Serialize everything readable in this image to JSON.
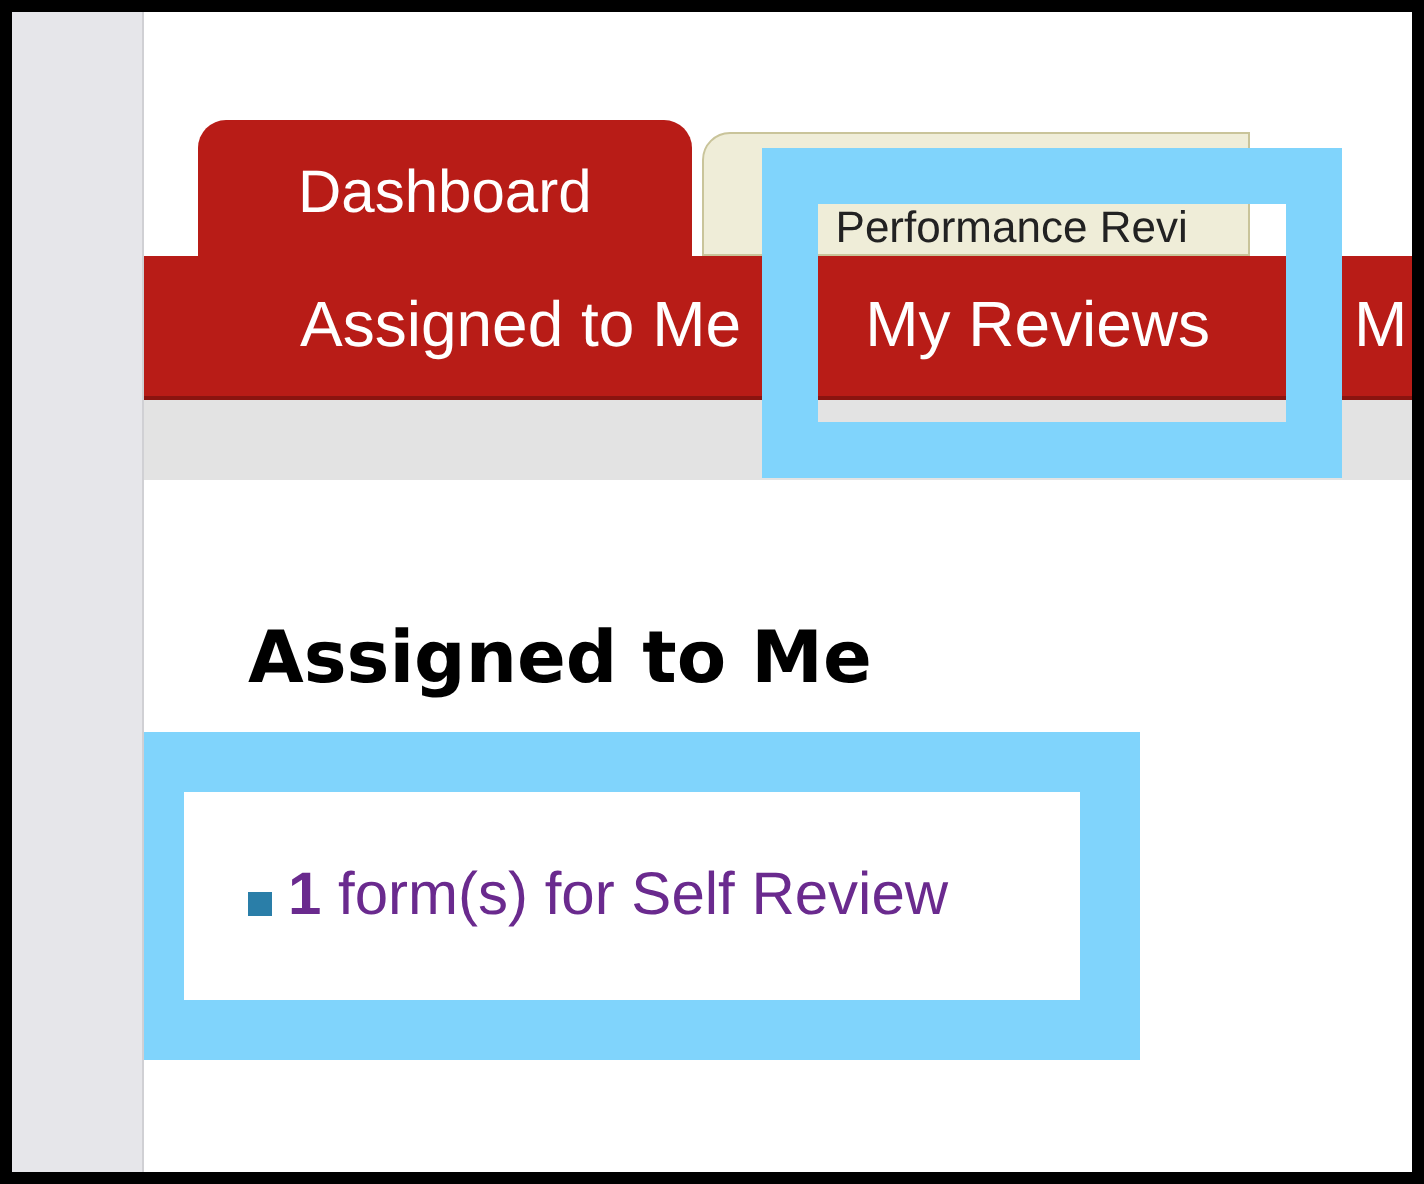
{
  "tabs": [
    {
      "label": "Dashboard",
      "selected": true
    },
    {
      "label": "Performance Revi",
      "selected": false
    }
  ],
  "submenu": [
    {
      "label": "Assigned to Me",
      "highlighted": false
    },
    {
      "label": "My Reviews",
      "highlighted": true
    },
    {
      "label": "M",
      "highlighted": false
    }
  ],
  "heading": "Assigned to Me",
  "items": [
    {
      "count": "1",
      "text": "form(s) for Self Review",
      "highlighted": true
    }
  ]
}
